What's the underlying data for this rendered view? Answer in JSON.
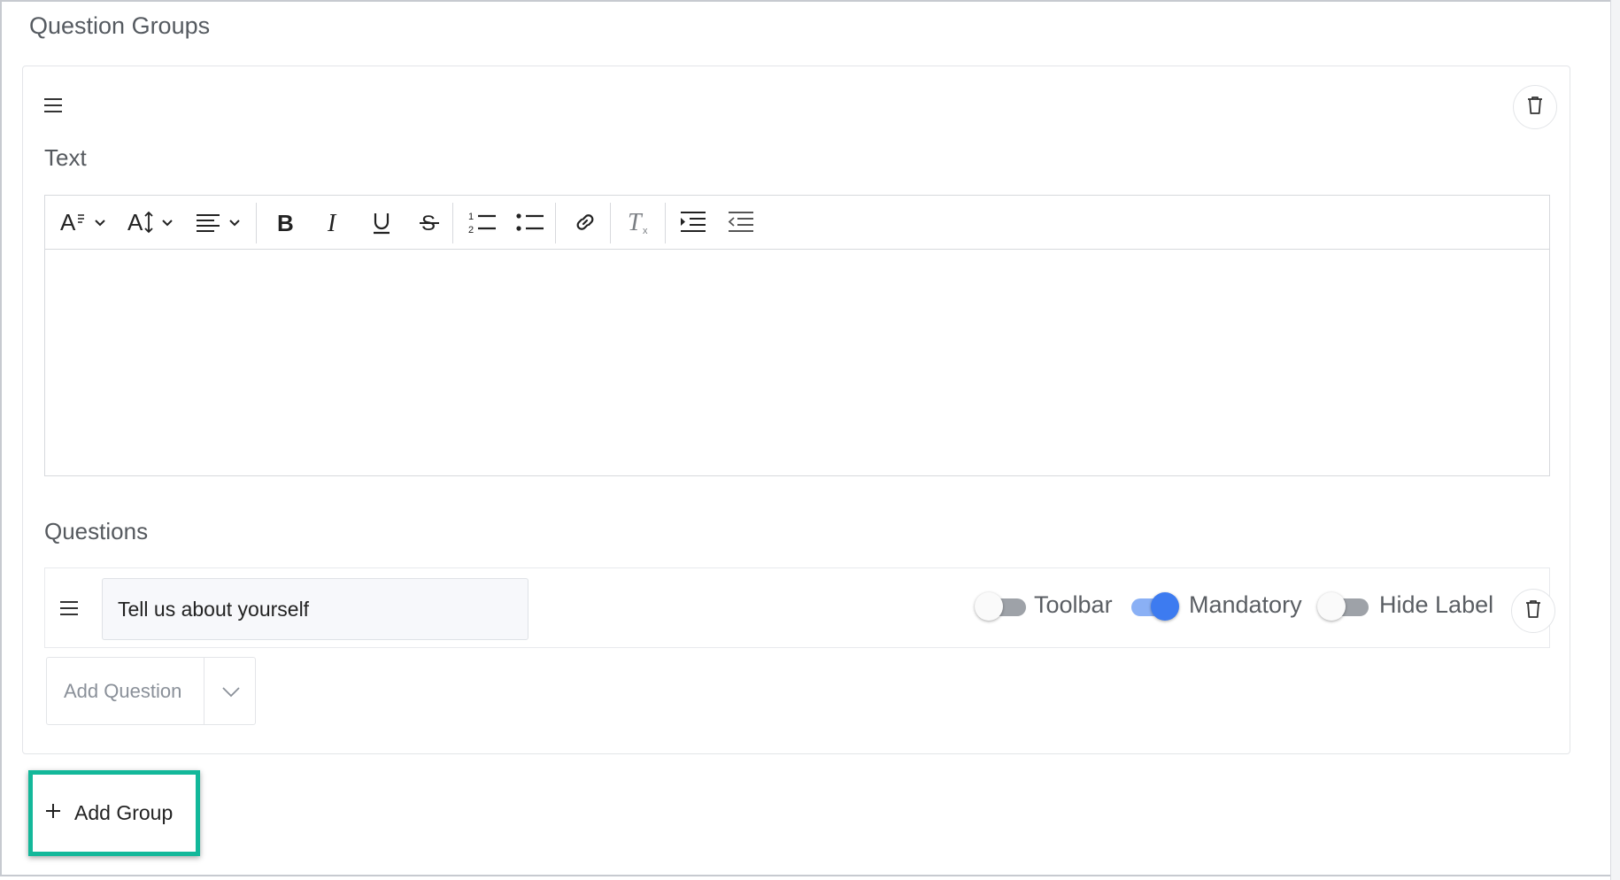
{
  "section": {
    "title": "Question Groups"
  },
  "group": {
    "text_label": "Text",
    "editor": {
      "toolbar": [
        "font-style-dropdown",
        "font-size-dropdown",
        "align-dropdown",
        "bold",
        "italic",
        "underline",
        "strikethrough",
        "ordered-list",
        "unordered-list",
        "link",
        "clear-formatting",
        "indent",
        "outdent"
      ],
      "content": ""
    },
    "questions_label": "Questions",
    "questions": [
      {
        "value": "Tell us about yourself",
        "toggles": {
          "toolbar": {
            "label": "Toolbar",
            "on": false
          },
          "mandatory": {
            "label": "Mandatory",
            "on": true
          },
          "hide_label": {
            "label": "Hide Label",
            "on": false
          }
        }
      }
    ],
    "add_question": {
      "label": "Add Question"
    }
  },
  "add_group": {
    "label": "Add Group"
  },
  "colors": {
    "highlight": "#13b89a",
    "toggle_on": "#3d7bf0",
    "toggle_off": "#9ea2a8"
  }
}
